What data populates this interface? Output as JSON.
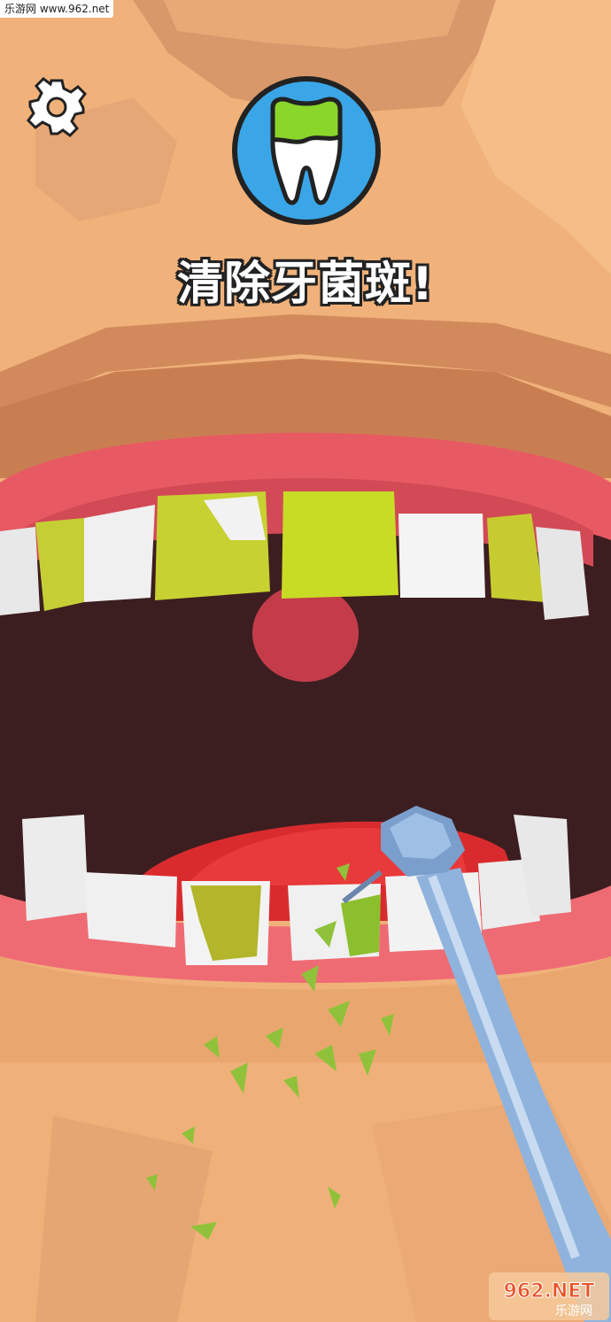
{
  "watermark_top": "乐游网 www.962.net",
  "instruction": "清除牙菌斑!",
  "watermark_bottom": {
    "brand": "962.NET",
    "sub": "乐游网"
  },
  "colors": {
    "skin": "#f0b27a",
    "gum": "#e85a63",
    "tooth": "#f2f2f2",
    "plaque": "#c5d12b",
    "badge_ring": "#3aa6e8",
    "tool": "#8fb3dd"
  },
  "icons": {
    "settings": "gear-icon",
    "task": "plaque-tooth-icon"
  }
}
